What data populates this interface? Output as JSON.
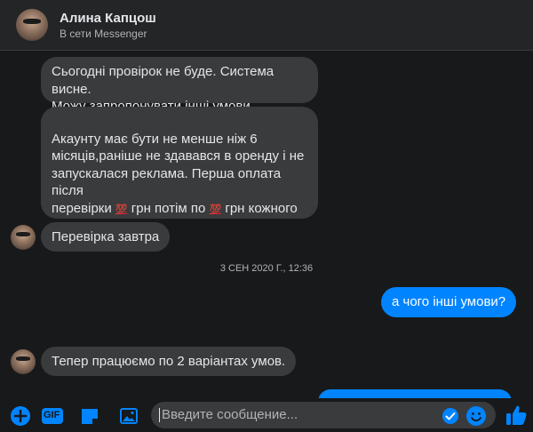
{
  "header": {
    "name": "Алина Капцош",
    "status": "В сети Messenger"
  },
  "messages": [
    {
      "from": "them",
      "text": "Сьогодні провірок не буде. Система висне.\nМожу запропонувати інші умови."
    },
    {
      "from": "them",
      "parts": [
        "Акаунту має бути не менше ніж 6\nмісяців,раніше не здавався в оренду і не\nзапускалася реклама. Перша оплата після\nперевірки ",
        "💯",
        " грн потім по ",
        "💯",
        " грн кожного\nтижня.\n???????"
      ]
    },
    {
      "from": "them",
      "text": "Перевірка завтра"
    },
    {
      "timestamp": "3 СЕН 2020 Г., 12:36"
    },
    {
      "from": "me",
      "text": "а чого інші умови?"
    },
    {
      "from": "them",
      "text": "Тепер працюємо по 2 варіантах умов."
    }
  ],
  "composer": {
    "placeholder": "Введите сообщение...",
    "gif_label": "GIF"
  },
  "colors": {
    "background": "#18191a",
    "bubble_them": "#3a3b3c",
    "bubble_me": "#0084ff",
    "accent": "#0084ff"
  },
  "icons": [
    "plus-circle-icon",
    "gif-icon",
    "sticker-icon",
    "image-icon",
    "send-check-icon",
    "emoji-icon",
    "thumbs-up-icon"
  ]
}
